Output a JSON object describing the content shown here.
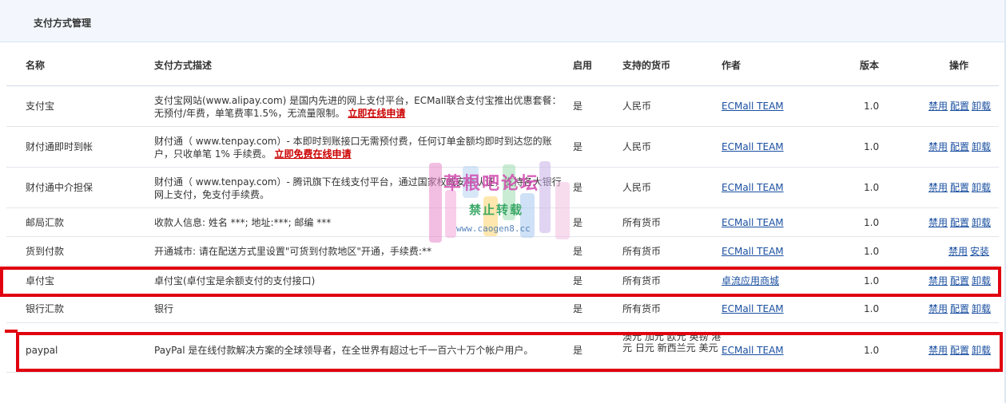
{
  "page": {
    "title": "支付方式管理"
  },
  "columns": {
    "name": "名称",
    "desc": "支付方式描述",
    "enabled": "启用",
    "currency": "支持的货币",
    "author": "作者",
    "version": "版本",
    "ops": "操作"
  },
  "rows": [
    {
      "name": "支付宝",
      "desc": "支付宝网站(www.alipay.com) 是国内先进的网上支付平台，ECMall联合支付宝推出优惠套餐：无预付/年费，单笔费率1.5%，无流量限制。",
      "apply": "立即在线申请",
      "enabled": "是",
      "currency": "人民币",
      "author": "ECMall TEAM",
      "version": "1.0",
      "ops": [
        "禁用",
        "配置",
        "卸载"
      ]
    },
    {
      "name": "财付通即时到帐",
      "desc": "财付通（ www.tenpay.com）- 本即时到账接口无需预付费，任何订单金额均即时到达您的账户，只收单笔 1% 手续费。",
      "apply": "立即免费在线申请",
      "enabled": "是",
      "currency": "人民币",
      "author": "ECMall TEAM",
      "version": "1.0",
      "ops": [
        "禁用",
        "配置",
        "卸载"
      ]
    },
    {
      "name": "财付通中介担保",
      "desc": "财付通（ www.tenpay.com）- 腾讯旗下在线支付平台，通过国家权威安全认证，支持各大银行网上支付，免支付手续费。",
      "apply": "",
      "enabled": "是",
      "currency": "人民币",
      "author": "ECMall TEAM",
      "version": "1.0",
      "ops": [
        "禁用",
        "配置",
        "卸载"
      ]
    },
    {
      "name": "邮局汇款",
      "desc": "收款人信息: 姓名 ***; 地址:***; 邮编 ***",
      "apply": "",
      "enabled": "是",
      "currency": "所有货币",
      "author": "ECMall TEAM",
      "version": "1.0",
      "ops": [
        "禁用",
        "配置",
        "卸载"
      ]
    },
    {
      "name": "货到付款",
      "desc": "开通城市: 请在配送方式里设置\"可货到付款地区\"开通，手续费:**",
      "apply": "",
      "enabled": "是",
      "currency": "所有货币",
      "author": "ECMall TEAM",
      "version": "1.0",
      "ops": [
        "禁用",
        "安装"
      ]
    },
    {
      "name": "卓付宝",
      "desc": "卓付宝(卓付宝是余额支付的支付接口)",
      "apply": "",
      "enabled": "是",
      "currency": "所有货币",
      "author": "卓流应用商城",
      "version": "1.0",
      "ops": [
        "禁用",
        "配置",
        "卸载"
      ]
    },
    {
      "name": "银行汇款",
      "desc": "银行",
      "apply": "",
      "enabled": "是",
      "currency": "所有货币",
      "author": "ECMall TEAM",
      "version": "1.0",
      "ops": [
        "禁用",
        "配置",
        "卸载"
      ]
    },
    {
      "name": "paypal",
      "desc": "PayPal 是在线付款解决方案的全球领导者，在全世界有超过七千一百六十万个帐户用户。",
      "apply": "",
      "enabled": "是",
      "currency": "澳元 加元 欧元 英镑 港元 日元 新西兰元 美元",
      "author": "ECMall TEAM",
      "version": "1.0",
      "ops": [
        "禁用",
        "配置",
        "卸载"
      ]
    }
  ],
  "watermark": {
    "title": "草根吧论坛",
    "subtitle": "禁止转载",
    "url": "www.caogen8.cc"
  },
  "colors": {
    "highlight": "#e0000f",
    "link": "#1a4fa0",
    "apply_link": "#cc0000",
    "header_bg": "#f3f7fd"
  }
}
